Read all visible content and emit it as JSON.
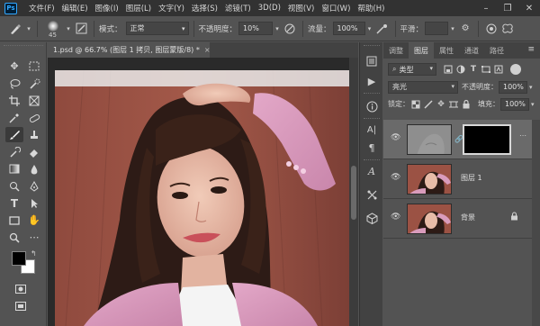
{
  "app": {
    "logo": "Ps",
    "menu": [
      "文件(F)",
      "编辑(E)",
      "图像(I)",
      "图层(L)",
      "文字(Y)",
      "选择(S)",
      "滤镜(T)",
      "3D(D)",
      "视图(V)",
      "窗口(W)",
      "帮助(H)"
    ],
    "window_controls": [
      "minimize-icon",
      "restore-icon",
      "close-icon"
    ]
  },
  "options": {
    "brush_size": "45",
    "mode_label": "模式：",
    "mode_value": "正常",
    "opacity_label": "不透明度：",
    "opacity_value": "10%",
    "flow_label": "流量：",
    "flow_value": "100%",
    "smoothing_label": "平滑：",
    "smoothing_value": ""
  },
  "toolbar": {
    "tools": [
      "move-tool-icon",
      "marquee-tool-icon",
      "lasso-tool-icon",
      "quick-select-tool-icon",
      "crop-tool-icon",
      "frame-tool-icon",
      "eyedropper-tool-icon",
      "healing-brush-icon",
      "brush-tool-icon",
      "clone-stamp-icon",
      "history-brush-icon",
      "eraser-tool-icon",
      "gradient-tool-icon",
      "blur-tool-icon",
      "dodge-tool-icon",
      "pen-tool-icon",
      "type-tool-icon",
      "path-select-icon",
      "rectangle-tool-icon",
      "hand-tool-icon",
      "zoom-tool-icon",
      "more-tools-icon"
    ],
    "foreground_color": "#000000",
    "background_color": "#ffffff"
  },
  "document": {
    "tab_title": "1.psd @ 66.7% (图层 1 拷贝, 图层蒙版/8) *",
    "close": "×"
  },
  "dock": [
    "history-icon",
    "actions-icon",
    "info-icon",
    "character-icon",
    "paragraph-icon",
    "glyphs-icon",
    "properties-icon",
    "3d-icon"
  ],
  "layers_panel": {
    "tabs": [
      "调整",
      "图层",
      "属性",
      "通道",
      "路径"
    ],
    "active_tab": "图层",
    "filter_label": "类型",
    "blend_mode": "亮光",
    "opacity_label": "不透明度：",
    "opacity_value": "100%",
    "lock_label": "锁定：",
    "fill_label": "填充：",
    "fill_value": "100%",
    "layers": [
      {
        "name": "",
        "selected": true,
        "has_mask": true
      },
      {
        "name": "图层 1",
        "selected": false
      },
      {
        "name": "背景",
        "selected": false,
        "locked": true
      }
    ]
  }
}
